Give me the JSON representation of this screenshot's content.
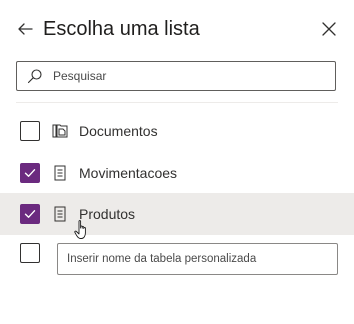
{
  "dialog": {
    "title": "Escolha uma lista",
    "back_icon": "arrow-left-icon",
    "close_icon": "close-icon"
  },
  "search": {
    "placeholder": "Pesquisar",
    "value": "",
    "icon": "search-icon"
  },
  "lists": [
    {
      "label": "Documentos",
      "checked": false,
      "icon": "document-library-icon"
    },
    {
      "label": "Movimentacoes",
      "checked": true,
      "icon": "list-icon"
    },
    {
      "label": "Produtos",
      "checked": true,
      "icon": "list-icon",
      "hovered": true
    }
  ],
  "custom_table": {
    "checked": false,
    "placeholder": "Inserir nome da tabela personalizada",
    "value": ""
  },
  "colors": {
    "accent": "#6b2a7f",
    "hover_row": "#edebe9",
    "text": "#323130"
  },
  "pointer": "hand-pointer-icon"
}
